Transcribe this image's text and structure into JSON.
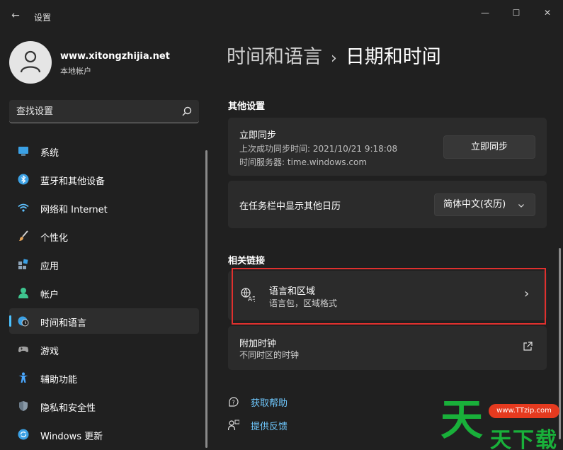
{
  "window": {
    "title": "设置",
    "back_glyph": "←",
    "min_glyph": "—",
    "max_glyph": "☐",
    "close_glyph": "✕"
  },
  "profile": {
    "name": "www.xitongzhijia.net",
    "account_type": "本地帐户"
  },
  "search": {
    "placeholder": "查找设置"
  },
  "sidebar": {
    "items": [
      {
        "label": "系统",
        "icon": "monitor-icon",
        "color": "#3ba1e5"
      },
      {
        "label": "蓝牙和其他设备",
        "icon": "bluetooth-icon",
        "color": "#3ba1e5"
      },
      {
        "label": "网络和 Internet",
        "icon": "wifi-icon",
        "color": "#5ec1ff"
      },
      {
        "label": "个性化",
        "icon": "brush-icon",
        "color": "#e3a35a"
      },
      {
        "label": "应用",
        "icon": "apps-icon",
        "color": "#8ea4b8"
      },
      {
        "label": "帐户",
        "icon": "person-icon",
        "color": "#3ec58f"
      },
      {
        "label": "时间和语言",
        "icon": "clock-globe-icon",
        "color": "#3ba1e5",
        "selected": true
      },
      {
        "label": "游戏",
        "icon": "gamepad-icon",
        "color": "#a0a0a0"
      },
      {
        "label": "辅助功能",
        "icon": "accessibility-icon",
        "color": "#4aa8ff"
      },
      {
        "label": "隐私和安全性",
        "icon": "shield-icon",
        "color": "#8a9aa8"
      },
      {
        "label": "Windows 更新",
        "icon": "update-icon",
        "color": "#3ba1e5"
      }
    ]
  },
  "breadcrumb": {
    "parent": "时间和语言",
    "separator": "›",
    "current": "日期和时间"
  },
  "other_settings": {
    "heading": "其他设置",
    "sync": {
      "title": "立即同步",
      "last_sync": "上次成功同步时间: 2021/10/21 9:18:08",
      "server": "时间服务器: time.windows.com",
      "button": "立即同步"
    },
    "calendar": {
      "title": "在任务栏中显示其他日历",
      "selected": "简体中文(农历)"
    }
  },
  "related_links": {
    "heading": "相关链接",
    "language_region": {
      "title": "语言和区域",
      "subtitle": "语言包，区域格式",
      "chevron": "›"
    },
    "additional_clocks": {
      "title": "附加时钟",
      "subtitle": "不同时区的时钟"
    }
  },
  "help": {
    "get_help": "获取帮助",
    "feedback": "提供反馈"
  },
  "logo": {
    "big_char": "天",
    "pill_text": "www.TTzip.com",
    "text": "天下载"
  },
  "colors": {
    "accent": "#4cc2ff",
    "highlight": "#e0302e",
    "link": "#6fc9ff"
  }
}
